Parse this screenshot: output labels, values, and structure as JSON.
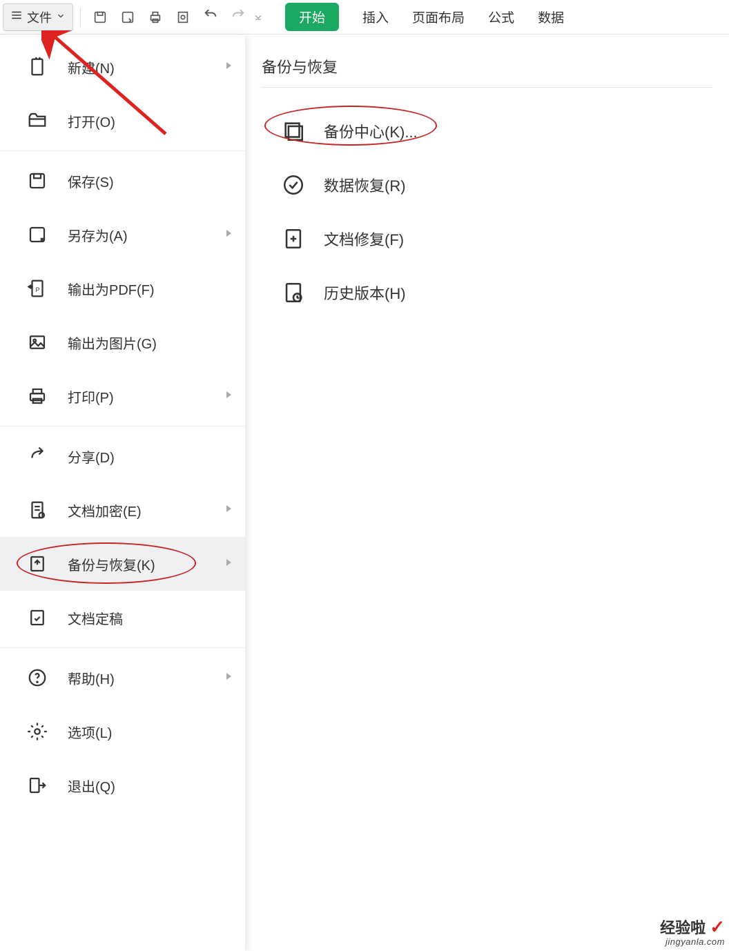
{
  "toolbar": {
    "file_label": "文件",
    "tabs": {
      "start": "开始",
      "insert": "插入",
      "layout": "页面布局",
      "formula": "公式",
      "data": "数据"
    }
  },
  "file_menu": [
    {
      "label": "新建(N)",
      "icon": "new-file-icon",
      "sub": true
    },
    {
      "label": "打开(O)",
      "icon": "folder-open-icon",
      "sub": false
    },
    {
      "label": "保存(S)",
      "icon": "save-icon",
      "sub": false
    },
    {
      "label": "另存为(A)",
      "icon": "save-as-icon",
      "sub": true
    },
    {
      "label": "输出为PDF(F)",
      "icon": "export-pdf-icon",
      "sub": false
    },
    {
      "label": "输出为图片(G)",
      "icon": "export-image-icon",
      "sub": false
    },
    {
      "label": "打印(P)",
      "icon": "print-icon",
      "sub": true
    },
    {
      "label": "分享(D)",
      "icon": "share-icon",
      "sub": false
    },
    {
      "label": "文档加密(E)",
      "icon": "encrypt-icon",
      "sub": true
    },
    {
      "label": "备份与恢复(K)",
      "icon": "backup-icon",
      "sub": true,
      "selected": true
    },
    {
      "label": "文档定稿",
      "icon": "finalize-icon",
      "sub": false
    },
    {
      "label": "帮助(H)",
      "icon": "help-icon",
      "sub": true
    },
    {
      "label": "选项(L)",
      "icon": "settings-icon",
      "sub": false
    },
    {
      "label": "退出(Q)",
      "icon": "exit-icon",
      "sub": false
    }
  ],
  "panel_title": "备份与恢复",
  "panel_items": [
    {
      "label": "备份中心(K)...",
      "icon": "backup-center-icon",
      "highlight": true
    },
    {
      "label": "数据恢复(R)",
      "icon": "data-recover-icon"
    },
    {
      "label": "文档修复(F)",
      "icon": "doc-repair-icon"
    },
    {
      "label": "历史版本(H)",
      "icon": "history-icon"
    }
  ],
  "watermark": {
    "top": "经验啦",
    "check": "✓",
    "bottom": "jingyanla.com"
  }
}
